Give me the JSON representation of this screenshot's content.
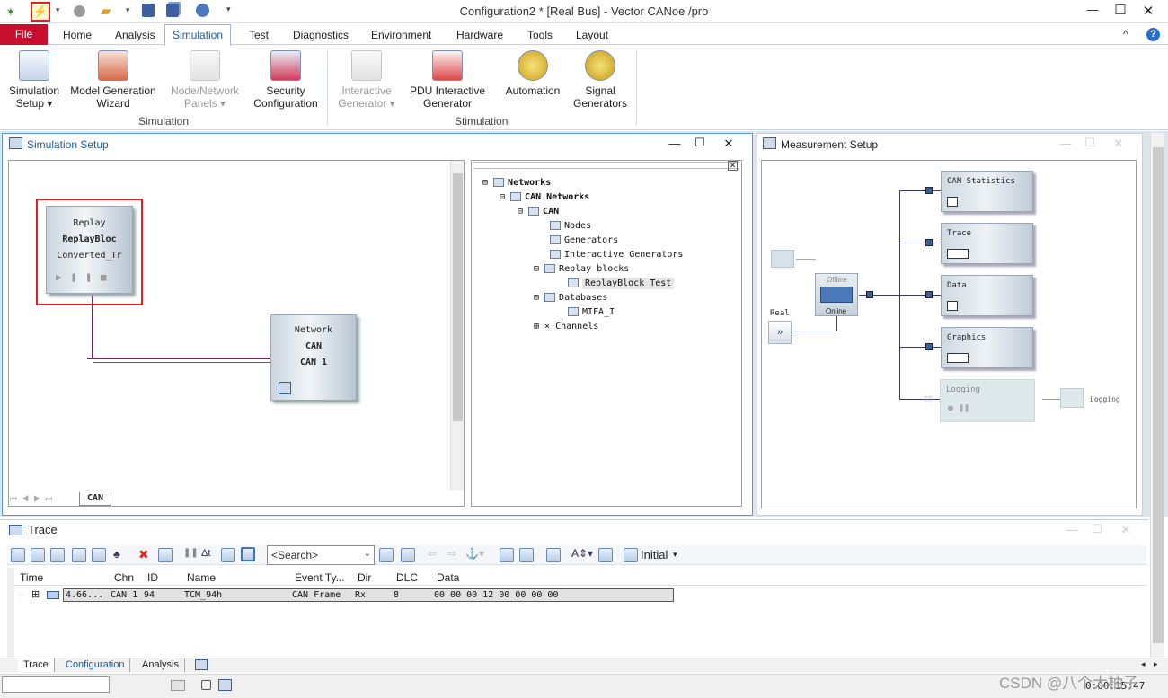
{
  "window": {
    "title": "Configuration2 * [Real Bus] - Vector CANoe /pro",
    "minimize": "—",
    "maximize": "☐",
    "close": "✕"
  },
  "menu": {
    "file": "File",
    "tabs": [
      "Home",
      "Analysis",
      "Simulation",
      "Test",
      "Diagnostics",
      "Environment",
      "Hardware",
      "Tools",
      "Layout"
    ],
    "help": "?",
    "collapse": "^"
  },
  "ribbon": {
    "simulation_group": "Simulation",
    "stimulation_group": "Stimulation",
    "buttons": [
      {
        "l1": "Simulation",
        "l2": "Setup ▾"
      },
      {
        "l1": "Model Generation",
        "l2": "Wizard"
      },
      {
        "l1": "Node/Network",
        "l2": "Panels ▾"
      },
      {
        "l1": "Security",
        "l2": "Configuration"
      },
      {
        "l1": "Interactive",
        "l2": "Generator ▾"
      },
      {
        "l1": "PDU Interactive",
        "l2": "Generator"
      },
      {
        "l1": "Automation",
        "l2": ""
      },
      {
        "l1": "Signal",
        "l2": "Generators"
      }
    ]
  },
  "sim_setup": {
    "title": "Simulation Setup",
    "replay": {
      "l1": "Replay",
      "l2": "ReplayBloc",
      "l3": "Converted_Tr"
    },
    "network": {
      "l1": "Network",
      "l2": "CAN",
      "l3": "CAN 1"
    },
    "bus_tab": "CAN",
    "tree": {
      "root": "Networks",
      "can_networks": "CAN Networks",
      "can": "CAN",
      "nodes": "Nodes",
      "generators": "Generators",
      "interactive": "Interactive Generators",
      "replay_blocks": "Replay blocks",
      "replay_item": "ReplayBlock Test",
      "databases": "Databases",
      "mifa": "MIFA_I",
      "channels": "Channels"
    }
  },
  "meas": {
    "title": "Measurement Setup",
    "real": "Real",
    "offline": "Offline",
    "online": "Online",
    "blocks": [
      "CAN Statistics",
      "Trace",
      "Data",
      "Graphics",
      "Logging"
    ],
    "logging_file": "Logging"
  },
  "trace": {
    "title": "Trace",
    "search_placeholder": "<Search>",
    "initial": "Initial",
    "columns": [
      "Time",
      "Chn",
      "ID",
      "Name",
      "Event Ty...",
      "Dir",
      "DLC",
      "Data"
    ],
    "rows": [
      {
        "time": "4.66...",
        "chn": "CAN 1",
        "id": "94",
        "name": "TCM_94h",
        "event": "CAN Frame",
        "dir": "Rx",
        "dlc": "8",
        "data": "00 00 00 12 00 00 00 00"
      }
    ]
  },
  "bottom_tabs": [
    "Trace",
    "Configuration",
    "Analysis"
  ],
  "status": {
    "time": "0:00:15:47",
    "watermark": "CSDN @八个大柚子"
  }
}
